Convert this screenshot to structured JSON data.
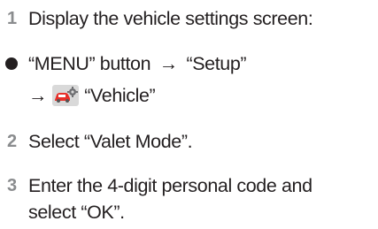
{
  "steps": [
    {
      "number": "1",
      "text": "Display the vehicle settings screen:"
    },
    {
      "number": "2",
      "text": "Select “Valet Mode”."
    },
    {
      "number": "3",
      "text_line1": "Enter the 4-digit personal code and",
      "text_line2": "select “OK”."
    }
  ],
  "bullet": {
    "part1": "“MENU” button",
    "arrow": "→",
    "part2": "“Setup”",
    "part3": "“Vehicle”",
    "icon": "car-gear-icon"
  },
  "colors": {
    "step_number": "#8a8c8e",
    "text": "#231f20",
    "icon_bg": "#d9d9d9",
    "icon_car": "#e8302a"
  }
}
